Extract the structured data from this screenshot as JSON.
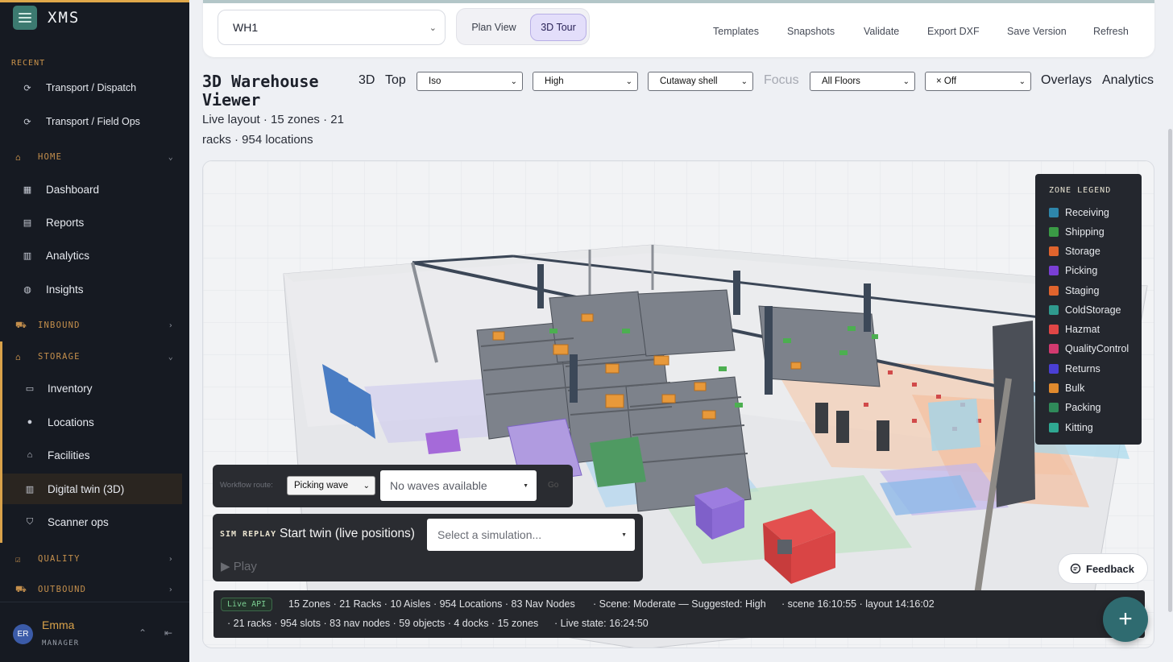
{
  "app": {
    "name": "XMS"
  },
  "sidebar": {
    "recent_label": "RECENT",
    "recent": [
      {
        "label": "Transport / Dispatch"
      },
      {
        "label": "Transport / Field Ops"
      }
    ],
    "home": {
      "label": "HOME"
    },
    "home_items": [
      {
        "label": "Dashboard"
      },
      {
        "label": "Reports"
      },
      {
        "label": "Analytics"
      },
      {
        "label": "Insights"
      }
    ],
    "inbound": {
      "label": "INBOUND"
    },
    "storage": {
      "label": "STORAGE"
    },
    "storage_items": [
      {
        "label": "Inventory"
      },
      {
        "label": "Locations"
      },
      {
        "label": "Facilities"
      },
      {
        "label": "Digital twin (3D)"
      },
      {
        "label": "Scanner ops"
      }
    ],
    "quality": {
      "label": "QUALITY"
    },
    "outbound": {
      "label": "OUTBOUND"
    },
    "user": {
      "initials": "ER",
      "name": "Emma",
      "role": "MANAGER"
    }
  },
  "toolbar": {
    "warehouse": "WH1",
    "view_plan": "Plan View",
    "view_3d": "3D Tour",
    "actions": [
      "Templates",
      "Snapshots",
      "Validate",
      "Export DXF",
      "Save Version",
      "Refresh"
    ]
  },
  "header": {
    "title": "3D Warehouse Viewer",
    "subtitle": "Live layout · 15 zones · 21 racks · 954 locations"
  },
  "controls": {
    "mode_3d": "3D",
    "mode_top": "Top",
    "camera": "Iso",
    "quality": "High",
    "shell": "Cutaway shell",
    "focus": "Focus",
    "floors": "All Floors",
    "filter": "× Off",
    "overlays": "Overlays",
    "analytics": "Analytics"
  },
  "legend": {
    "title": "ZONE LEGEND",
    "items": [
      {
        "label": "Receiving",
        "color": "#2e86ab"
      },
      {
        "label": "Shipping",
        "color": "#3a9a45"
      },
      {
        "label": "Storage",
        "color": "#e0642d"
      },
      {
        "label": "Picking",
        "color": "#7a3fd4"
      },
      {
        "label": "Staging",
        "color": "#e0642d"
      },
      {
        "label": "ColdStorage",
        "color": "#2f9a8e"
      },
      {
        "label": "Hazmat",
        "color": "#e04646"
      },
      {
        "label": "QualityControl",
        "color": "#d23a6f"
      },
      {
        "label": "Returns",
        "color": "#4a3fd4"
      },
      {
        "label": "Bulk",
        "color": "#e08a2d"
      },
      {
        "label": "Packing",
        "color": "#2f8a5a"
      },
      {
        "label": "Kitting",
        "color": "#2fa892"
      }
    ]
  },
  "workflow": {
    "label": "Workflow route:",
    "route": "Picking wave",
    "waves_placeholder": "No waves available",
    "go": "Go"
  },
  "sim": {
    "label": "SIM REPLAY",
    "start": "Start twin (live positions)",
    "select_placeholder": "Select a simulation...",
    "play": "▶ Play"
  },
  "feedback": {
    "label": "Feedback"
  },
  "status": {
    "badge": "Live API",
    "summary": "15 Zones · 21 Racks · 10 Aisles · 954 Locations · 83 Nav Nodes",
    "scene": "· Scene: Moderate — Suggested: High",
    "times": "· scene 16:10:55 · layout 14:16:02",
    "counts": "· 21 racks · 954 slots · 83 nav nodes · 59 objects · 4 docks · 15 zones",
    "live": "· Live state: 16:24:50"
  },
  "fab": {
    "label": "+"
  }
}
